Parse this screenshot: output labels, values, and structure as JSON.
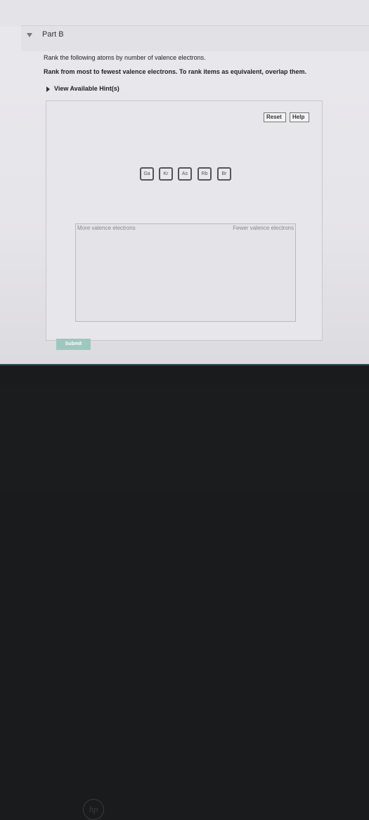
{
  "part": {
    "title": "Part B"
  },
  "instructions": {
    "line1": "Rank the following atoms by number of valence electrons.",
    "line2": "Rank from most to fewest valence electrons. To rank items as equivalent, overlap them."
  },
  "hints": {
    "label": "View Available Hint(s)"
  },
  "toolbar": {
    "reset_label": "Reset",
    "help_label": "Help"
  },
  "items": [
    "Ga",
    "Kr",
    "As",
    "Rb",
    "Br"
  ],
  "ranking": {
    "left_label": "More valence electrons",
    "right_label": "Fewer valence electrons"
  },
  "submit_label": "Submit",
  "device": {
    "brand": "hp"
  },
  "colors": {
    "submit_bg": "#9fc7bf",
    "taskbar_bg": "#2f4f58"
  }
}
